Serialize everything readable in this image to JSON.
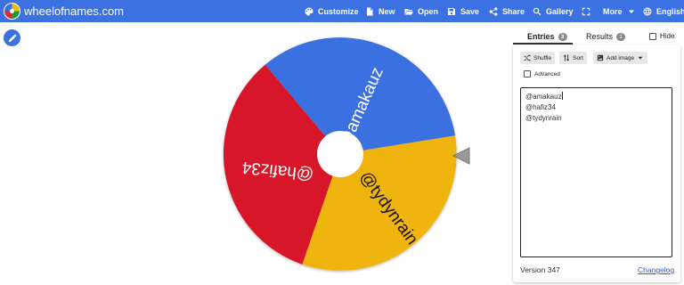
{
  "header": {
    "site_title": "wheelofnames.com",
    "menu": [
      {
        "label": "Customize",
        "icon": "palette-icon"
      },
      {
        "label": "New",
        "icon": "new-file-icon"
      },
      {
        "label": "Open",
        "icon": "folder-open-icon"
      },
      {
        "label": "Save",
        "icon": "save-icon"
      },
      {
        "label": "Share",
        "icon": "share-icon"
      },
      {
        "label": "Gallery",
        "icon": "search-icon"
      },
      {
        "label": "",
        "icon": "fullscreen-icon"
      },
      {
        "label": "More",
        "icon": "chevron-down-icon"
      },
      {
        "label": "English",
        "icon": "globe-icon"
      }
    ],
    "bar_color": "#3b71e0"
  },
  "wheel": {
    "segments": [
      {
        "label": "@amakauz",
        "color": "#3b6fe0"
      },
      {
        "label": "@tydynrain",
        "color": "#efb40f"
      },
      {
        "label": "@hafiz34",
        "color": "#d8142a"
      }
    ]
  },
  "panel": {
    "tabs": [
      {
        "label": "Entries",
        "count": "3"
      },
      {
        "label": "Results",
        "count": "1"
      }
    ],
    "hide_label": "Hide",
    "tools": {
      "shuffle": "Shuffle",
      "sort": "Sort",
      "add_image": "Add image"
    },
    "advanced_label": "Advanced",
    "entries": [
      "@amakauz",
      "@hafiz34",
      "@tydynrain"
    ],
    "version": "Version 347",
    "changelog": "Changelog"
  }
}
